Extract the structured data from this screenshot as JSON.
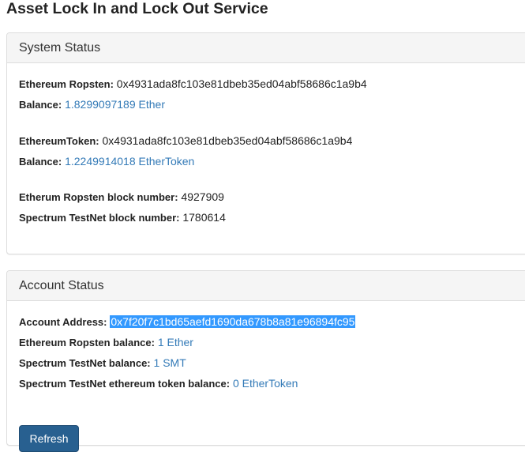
{
  "page": {
    "title": "Asset Lock In and Lock Out Service"
  },
  "system_status": {
    "heading": "System Status",
    "eth_ropsten_label": "Ethereum Ropsten:",
    "eth_ropsten_address": "0x4931ada8fc103e81dbeb35ed04abf58686c1a9b4",
    "balance_label_1": "Balance:",
    "balance_value_1": "1.8299097189 Ether",
    "eth_token_label": "EthereumToken:",
    "eth_token_address": "0x4931ada8fc103e81dbeb35ed04abf58686c1a9b4",
    "balance_label_2": "Balance:",
    "balance_value_2": "1.2249914018 EtherToken",
    "ropsten_block_label": "Etherum Ropsten block number:",
    "ropsten_block_value": "4927909",
    "spectrum_block_label": "Spectrum TestNet block number:",
    "spectrum_block_value": "1780614"
  },
  "account_status": {
    "heading": "Account Status",
    "address_label": "Account Address:",
    "address_value": "0x7f20f7c1bd65aefd1690da678b8a81e96894fc95",
    "ropsten_balance_label": "Ethereum Ropsten balance:",
    "ropsten_balance_value": "1 Ether",
    "spectrum_balance_label": "Spectrum TestNet balance:",
    "spectrum_balance_value": "1 SMT",
    "token_balance_label": "Spectrum TestNet ethereum token balance:",
    "token_balance_value": "0 EtherToken",
    "refresh_label": "Refresh"
  },
  "colors": {
    "link_blue": "#337ab7",
    "button_blue": "#286090",
    "selection_blue": "#3399ff",
    "panel_heading_bg": "#f5f5f5"
  }
}
